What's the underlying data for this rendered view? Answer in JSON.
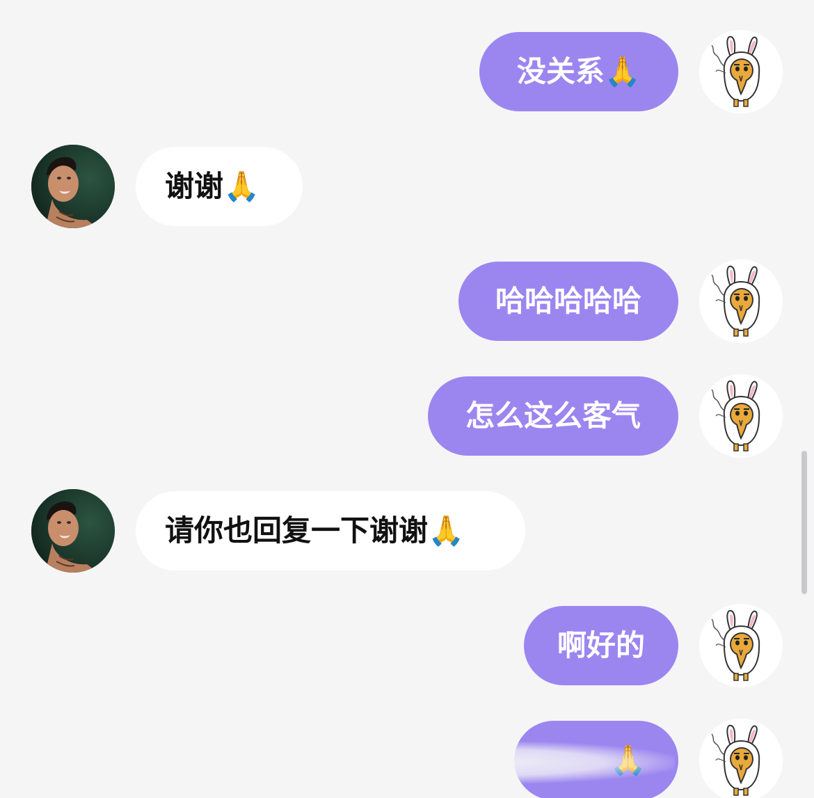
{
  "messages": [
    {
      "sender": "self",
      "text": "没关系🙏"
    },
    {
      "sender": "other",
      "text": "谢谢🙏"
    },
    {
      "sender": "self",
      "text": "哈哈哈哈哈"
    },
    {
      "sender": "self",
      "text": "怎么这么客气"
    },
    {
      "sender": "other",
      "text": "请你也回复一下谢谢🙏"
    },
    {
      "sender": "self",
      "text": "啊好的"
    },
    {
      "sender": "self",
      "text": "🙏"
    }
  ],
  "colors": {
    "background": "#f5f5f6",
    "self_bubble": "#9b86f0",
    "other_bubble": "#ffffff",
    "self_text": "#ffffff",
    "other_text": "#111111"
  },
  "icons": {
    "self_avatar": "bunny-costume-character-avatar",
    "other_avatar": "person-in-water-avatar"
  }
}
